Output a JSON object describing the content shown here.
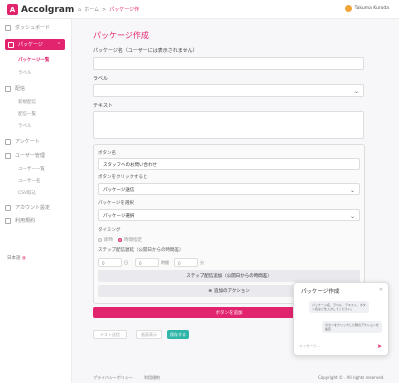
{
  "app": {
    "logo_letter": "A",
    "name": "Accolgram",
    "brand_color": "#e2246f"
  },
  "breadcrumb": {
    "home": "ホーム",
    "separator": ">",
    "current": "パッケージ作"
  },
  "user": {
    "name": "Takuma Kuroda"
  },
  "sidebar": {
    "items": [
      {
        "label": "ダッシュボード",
        "icon": "grid-icon"
      },
      {
        "label": "パッケージ",
        "icon": "package-icon",
        "active": true
      },
      {
        "label": "配信",
        "icon": "send-icon"
      },
      {
        "label": "アンケート",
        "icon": "survey-icon"
      },
      {
        "label": "ユーザー管理",
        "icon": "users-icon"
      },
      {
        "label": "アカウント設定",
        "icon": "gear-icon"
      },
      {
        "label": "利用規約",
        "icon": "doc-icon"
      }
    ],
    "package_sub": [
      "パッケージ一覧",
      "ラベル"
    ],
    "delivery_sub": [
      "新規配信",
      "配信一覧",
      "ラベル"
    ],
    "user_sub": [
      "ユーザー一覧",
      "ユーザー名",
      "CSV取込"
    ],
    "language": "日本語"
  },
  "form": {
    "page_title": "パッケージ作成",
    "name_label": "パッケージ名（ユーザーには表示されません）",
    "label_label": "ラベル",
    "text_label": "テキスト",
    "button_name_label": "ボタン名",
    "button_name_value": "スタッフへのお問い合わせ",
    "on_click_label": "ボタンをクリックすると",
    "on_click_value": "パッケージ送信",
    "select_package_label": "パッケージを選択",
    "select_package_value": "パッケージ選択",
    "timing_label": "タイミング",
    "timing_options": [
      "即時",
      "時間指定"
    ],
    "delay_label": "ステップ配信遅延（公開日からの時間差）",
    "delay_units": [
      "日",
      "時間",
      "分"
    ],
    "delay_values": [
      "0",
      "0",
      "0"
    ],
    "add_step_button": "ステップ配信追加（公開日からの時間差）",
    "add_action_button": "追加のアクション",
    "save_button": "ボタンを追加",
    "bottom_buttons": [
      "テスト送信",
      "画面表示",
      "保存する"
    ]
  },
  "chat": {
    "title": "パッケージ作成",
    "bubble1": "パッケージ名、ラベル、テキスト、ボタン名などを入力してください。",
    "bubble2": "ボタンをクリックした時のアクションを設定",
    "input_placeholder": "メッセージ..."
  },
  "footer": {
    "privacy": "プライバシーポリシー",
    "terms": "利用規約",
    "copyright": "Copyright © . All rights reserved."
  }
}
